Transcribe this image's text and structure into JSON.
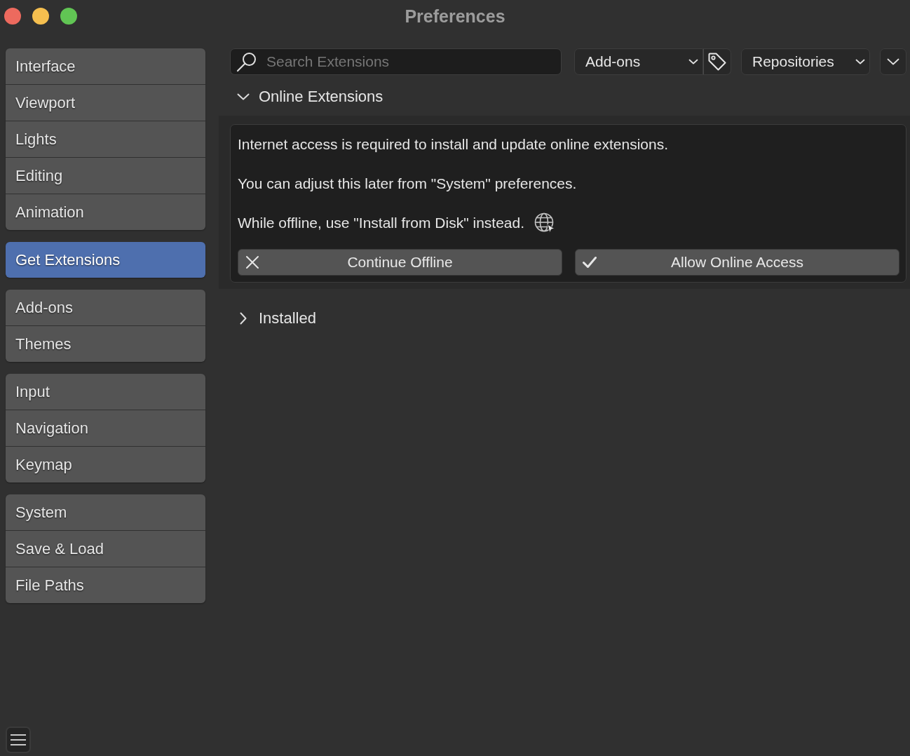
{
  "window": {
    "title": "Preferences"
  },
  "sidebar": {
    "groups": [
      {
        "items": [
          {
            "label": "Interface",
            "selected": false
          },
          {
            "label": "Viewport",
            "selected": false
          },
          {
            "label": "Lights",
            "selected": false
          },
          {
            "label": "Editing",
            "selected": false
          },
          {
            "label": "Animation",
            "selected": false
          }
        ]
      },
      {
        "items": [
          {
            "label": "Get Extensions",
            "selected": true
          }
        ]
      },
      {
        "items": [
          {
            "label": "Add-ons",
            "selected": false
          },
          {
            "label": "Themes",
            "selected": false
          }
        ]
      },
      {
        "items": [
          {
            "label": "Input",
            "selected": false
          },
          {
            "label": "Navigation",
            "selected": false
          },
          {
            "label": "Keymap",
            "selected": false
          }
        ]
      },
      {
        "items": [
          {
            "label": "System",
            "selected": false
          },
          {
            "label": "Save & Load",
            "selected": false
          },
          {
            "label": "File Paths",
            "selected": false
          }
        ]
      }
    ]
  },
  "toolbar": {
    "search": {
      "placeholder": "Search Extensions"
    },
    "filter_dropdown": {
      "value": "Add-ons"
    },
    "repositories_dropdown": {
      "value": "Repositories"
    }
  },
  "online_extensions": {
    "title": "Online Extensions",
    "expanded": true,
    "messages": [
      "Internet access is required to install and update online extensions.",
      "You can adjust this later from \"System\" preferences.",
      "While offline, use \"Install from Disk\" instead."
    ],
    "buttons": [
      {
        "label": "Continue Offline",
        "kind": "cancel"
      },
      {
        "label": "Allow Online Access",
        "kind": "confirm"
      }
    ]
  },
  "installed": {
    "title": "Installed",
    "expanded": false
  }
}
